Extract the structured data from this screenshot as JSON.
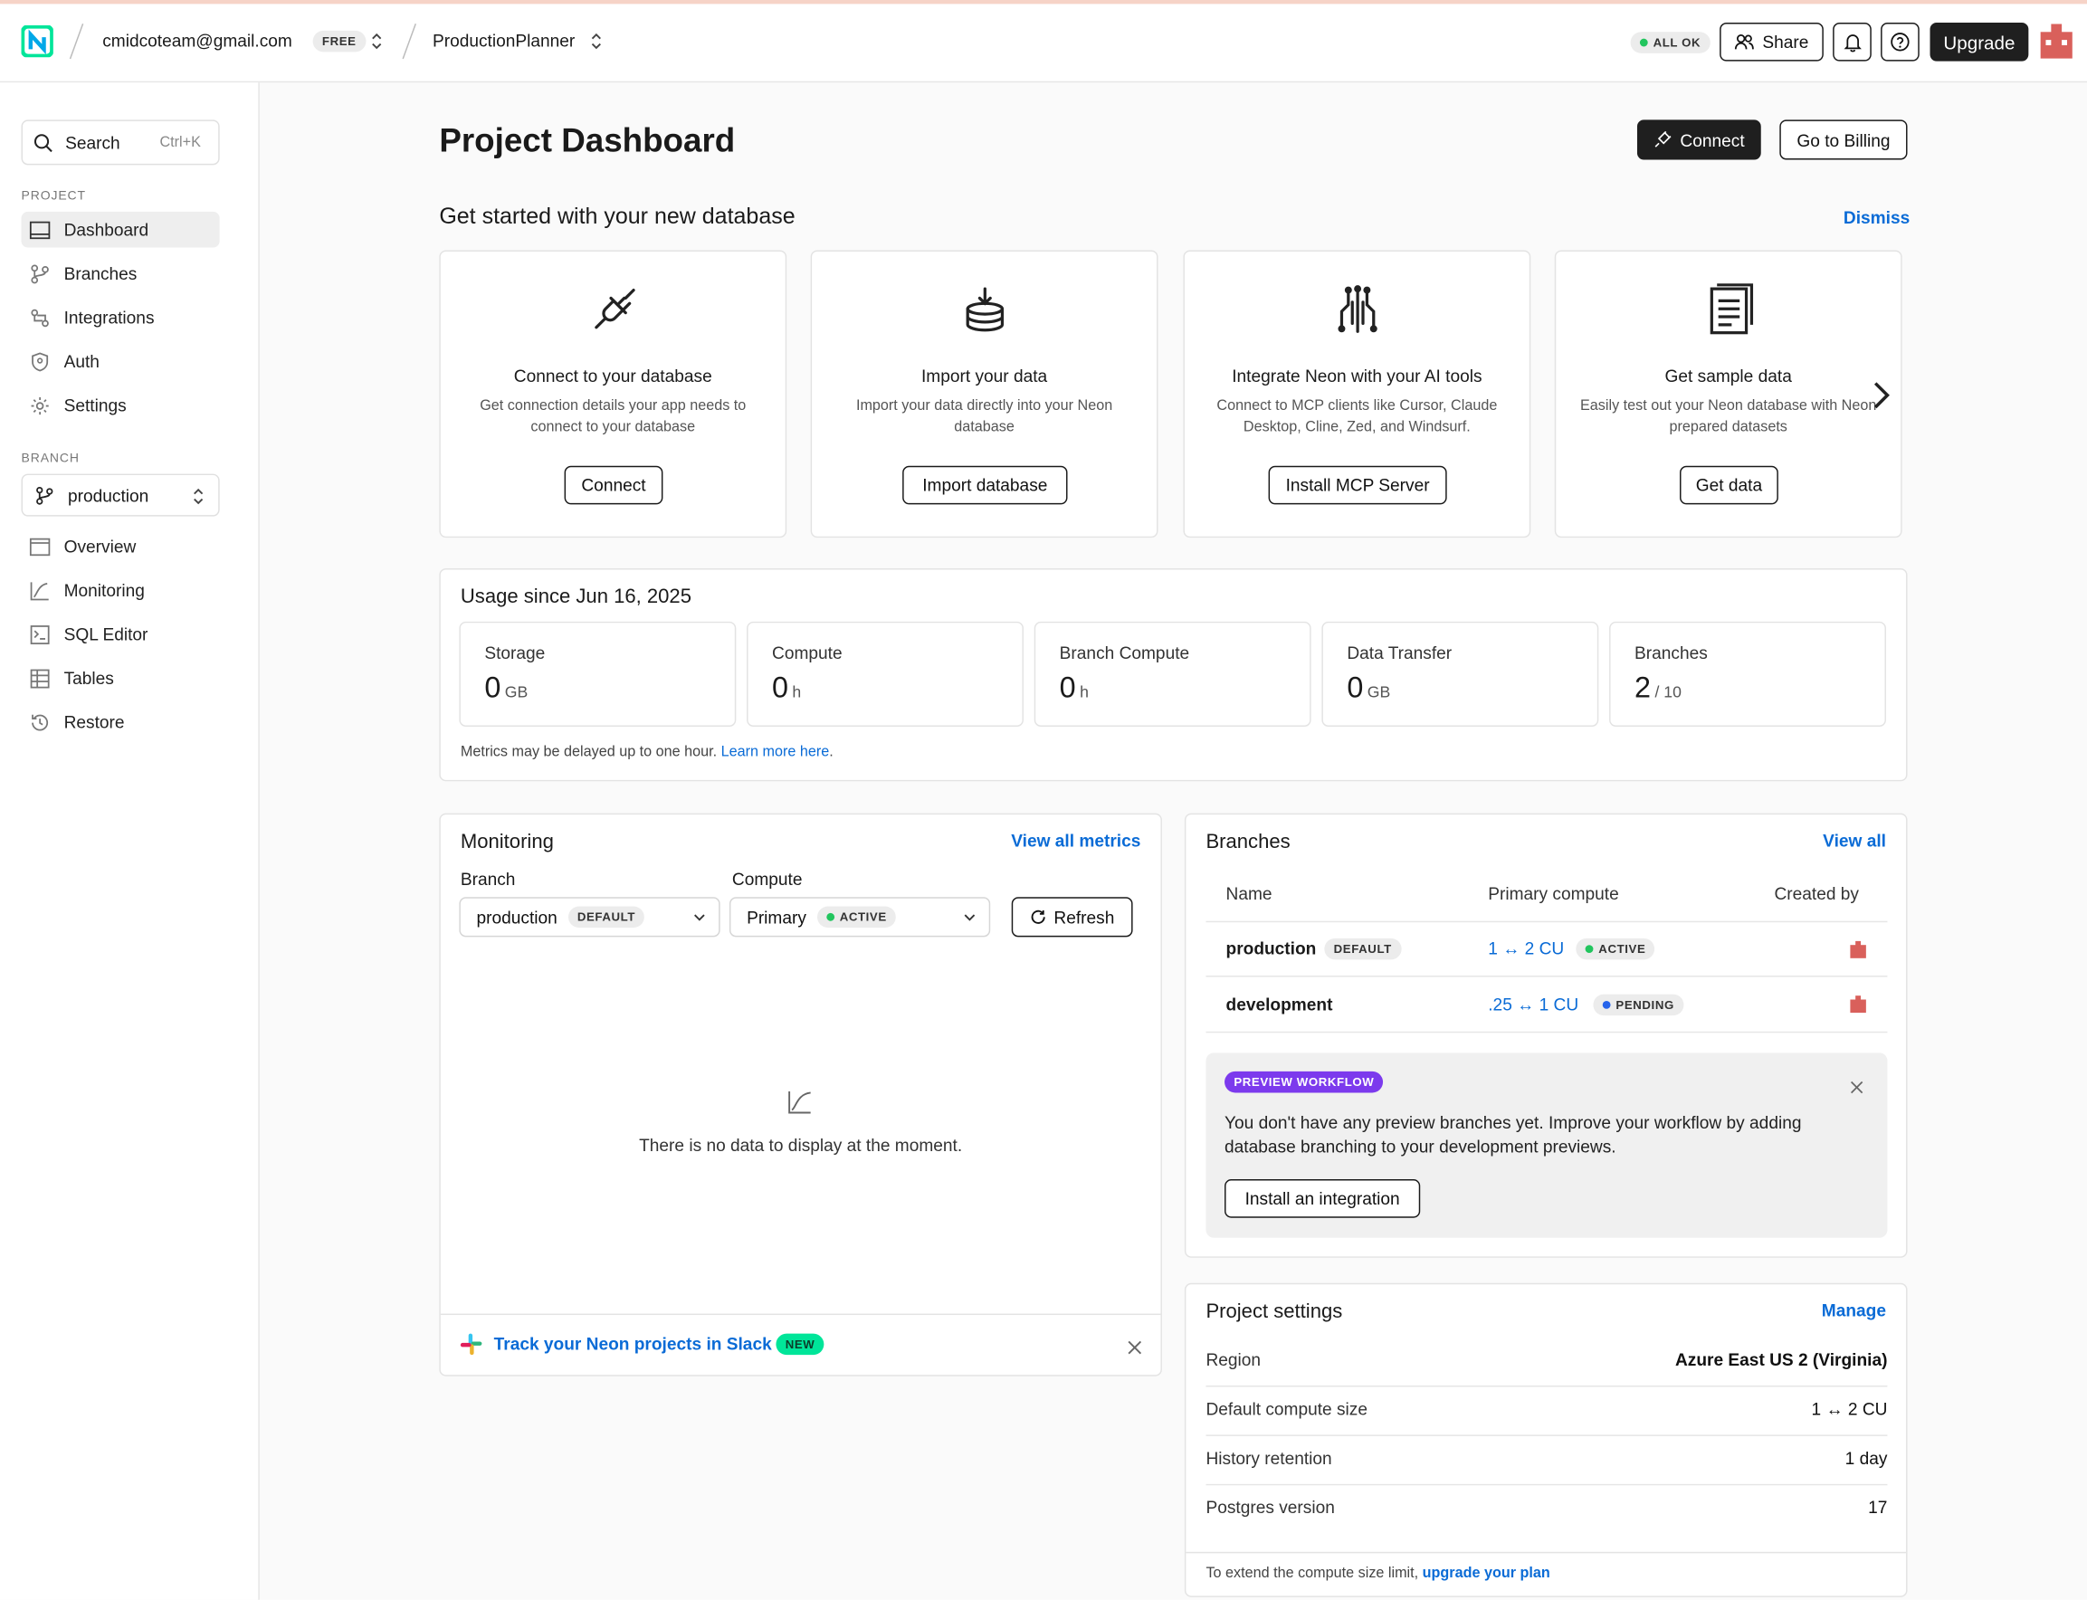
{
  "topbar": {
    "account_email": "cmidcoteam@gmail.com",
    "plan_badge": "FREE",
    "project_name": "ProductionPlanner",
    "status_badge": "ALL OK",
    "share_label": "Share",
    "upgrade_label": "Upgrade"
  },
  "sidebar": {
    "search_label": "Search",
    "search_shortcut": "Ctrl+K",
    "project_section": "PROJECT",
    "project_items": [
      "Dashboard",
      "Branches",
      "Integrations",
      "Auth",
      "Settings"
    ],
    "branch_section": "BRANCH",
    "branch_selected": "production",
    "branch_items": [
      "Overview",
      "Monitoring",
      "SQL Editor",
      "Tables",
      "Restore"
    ]
  },
  "header": {
    "title": "Project Dashboard",
    "connect_label": "Connect",
    "billing_label": "Go to Billing"
  },
  "get_started": {
    "title": "Get started with your new database",
    "dismiss_label": "Dismiss",
    "cards": [
      {
        "icon": "plug-icon",
        "title": "Connect to your database",
        "desc": "Get connection details your app needs to connect to your database",
        "button": "Connect"
      },
      {
        "icon": "database-import-icon",
        "title": "Import your data",
        "desc": "Import your data directly into your Neon database",
        "button": "Import database"
      },
      {
        "icon": "circuit-icon",
        "title": "Integrate Neon with your AI tools",
        "desc": "Connect to MCP clients like Cursor, Claude Desktop, Cline, Zed, and Windsurf.",
        "button": "Install MCP Server"
      },
      {
        "icon": "document-icon",
        "title": "Get sample data",
        "desc": "Easily test out your Neon database with Neon prepared datasets",
        "button": "Get data"
      }
    ]
  },
  "usage": {
    "title": "Usage since Jun 16, 2025",
    "metrics": [
      {
        "label": "Storage",
        "value": "0",
        "unit": "GB"
      },
      {
        "label": "Compute",
        "value": "0",
        "unit": "h"
      },
      {
        "label": "Branch Compute",
        "value": "0",
        "unit": "h"
      },
      {
        "label": "Data Transfer",
        "value": "0",
        "unit": "GB"
      },
      {
        "label": "Branches",
        "value": "2",
        "unit": "/ 10"
      }
    ],
    "note": "Metrics may be delayed up to one hour.",
    "note_link": "Learn more here",
    "note_end": "."
  },
  "monitoring": {
    "title": "Monitoring",
    "view_all": "View all metrics",
    "branch_label": "Branch",
    "branch_value": "production",
    "branch_badge": "DEFAULT",
    "compute_label": "Compute",
    "compute_value": "Primary",
    "compute_badge": "ACTIVE",
    "refresh_label": "Refresh",
    "empty_text": "There is no data to display at the moment.",
    "slack_text": "Track your Neon projects in Slack",
    "slack_badge": "NEW"
  },
  "branches": {
    "title": "Branches",
    "view_all": "View all",
    "columns": [
      "Name",
      "Primary compute",
      "Created by"
    ],
    "rows": [
      {
        "name": "production",
        "badge": "DEFAULT",
        "compute": "1 ↔ 2 CU",
        "status": "ACTIVE"
      },
      {
        "name": "development",
        "badge": "",
        "compute": ".25 ↔ 1 CU",
        "status": "PENDING"
      }
    ],
    "preview": {
      "badge": "PREVIEW WORKFLOW",
      "text": "You don't have any preview branches yet. Improve your workflow by adding database branching to your development previews.",
      "button": "Install an integration"
    }
  },
  "project_settings": {
    "title": "Project settings",
    "manage": "Manage",
    "rows": [
      {
        "key": "Region",
        "value": "Azure East US 2 (Virginia)"
      },
      {
        "key": "Default compute size",
        "value": "1 ↔ 2 CU"
      },
      {
        "key": "History retention",
        "value": "1 day"
      },
      {
        "key": "Postgres version",
        "value": "17"
      }
    ],
    "footer": "To extend the compute size limit,",
    "footer_link": "upgrade your plan"
  },
  "colors": {
    "accent_link": "#0a6bd6",
    "status_green": "#22c55e",
    "status_blue": "#2563eb",
    "preview_purple": "#7c3aed",
    "logo_green": "#00e599"
  }
}
